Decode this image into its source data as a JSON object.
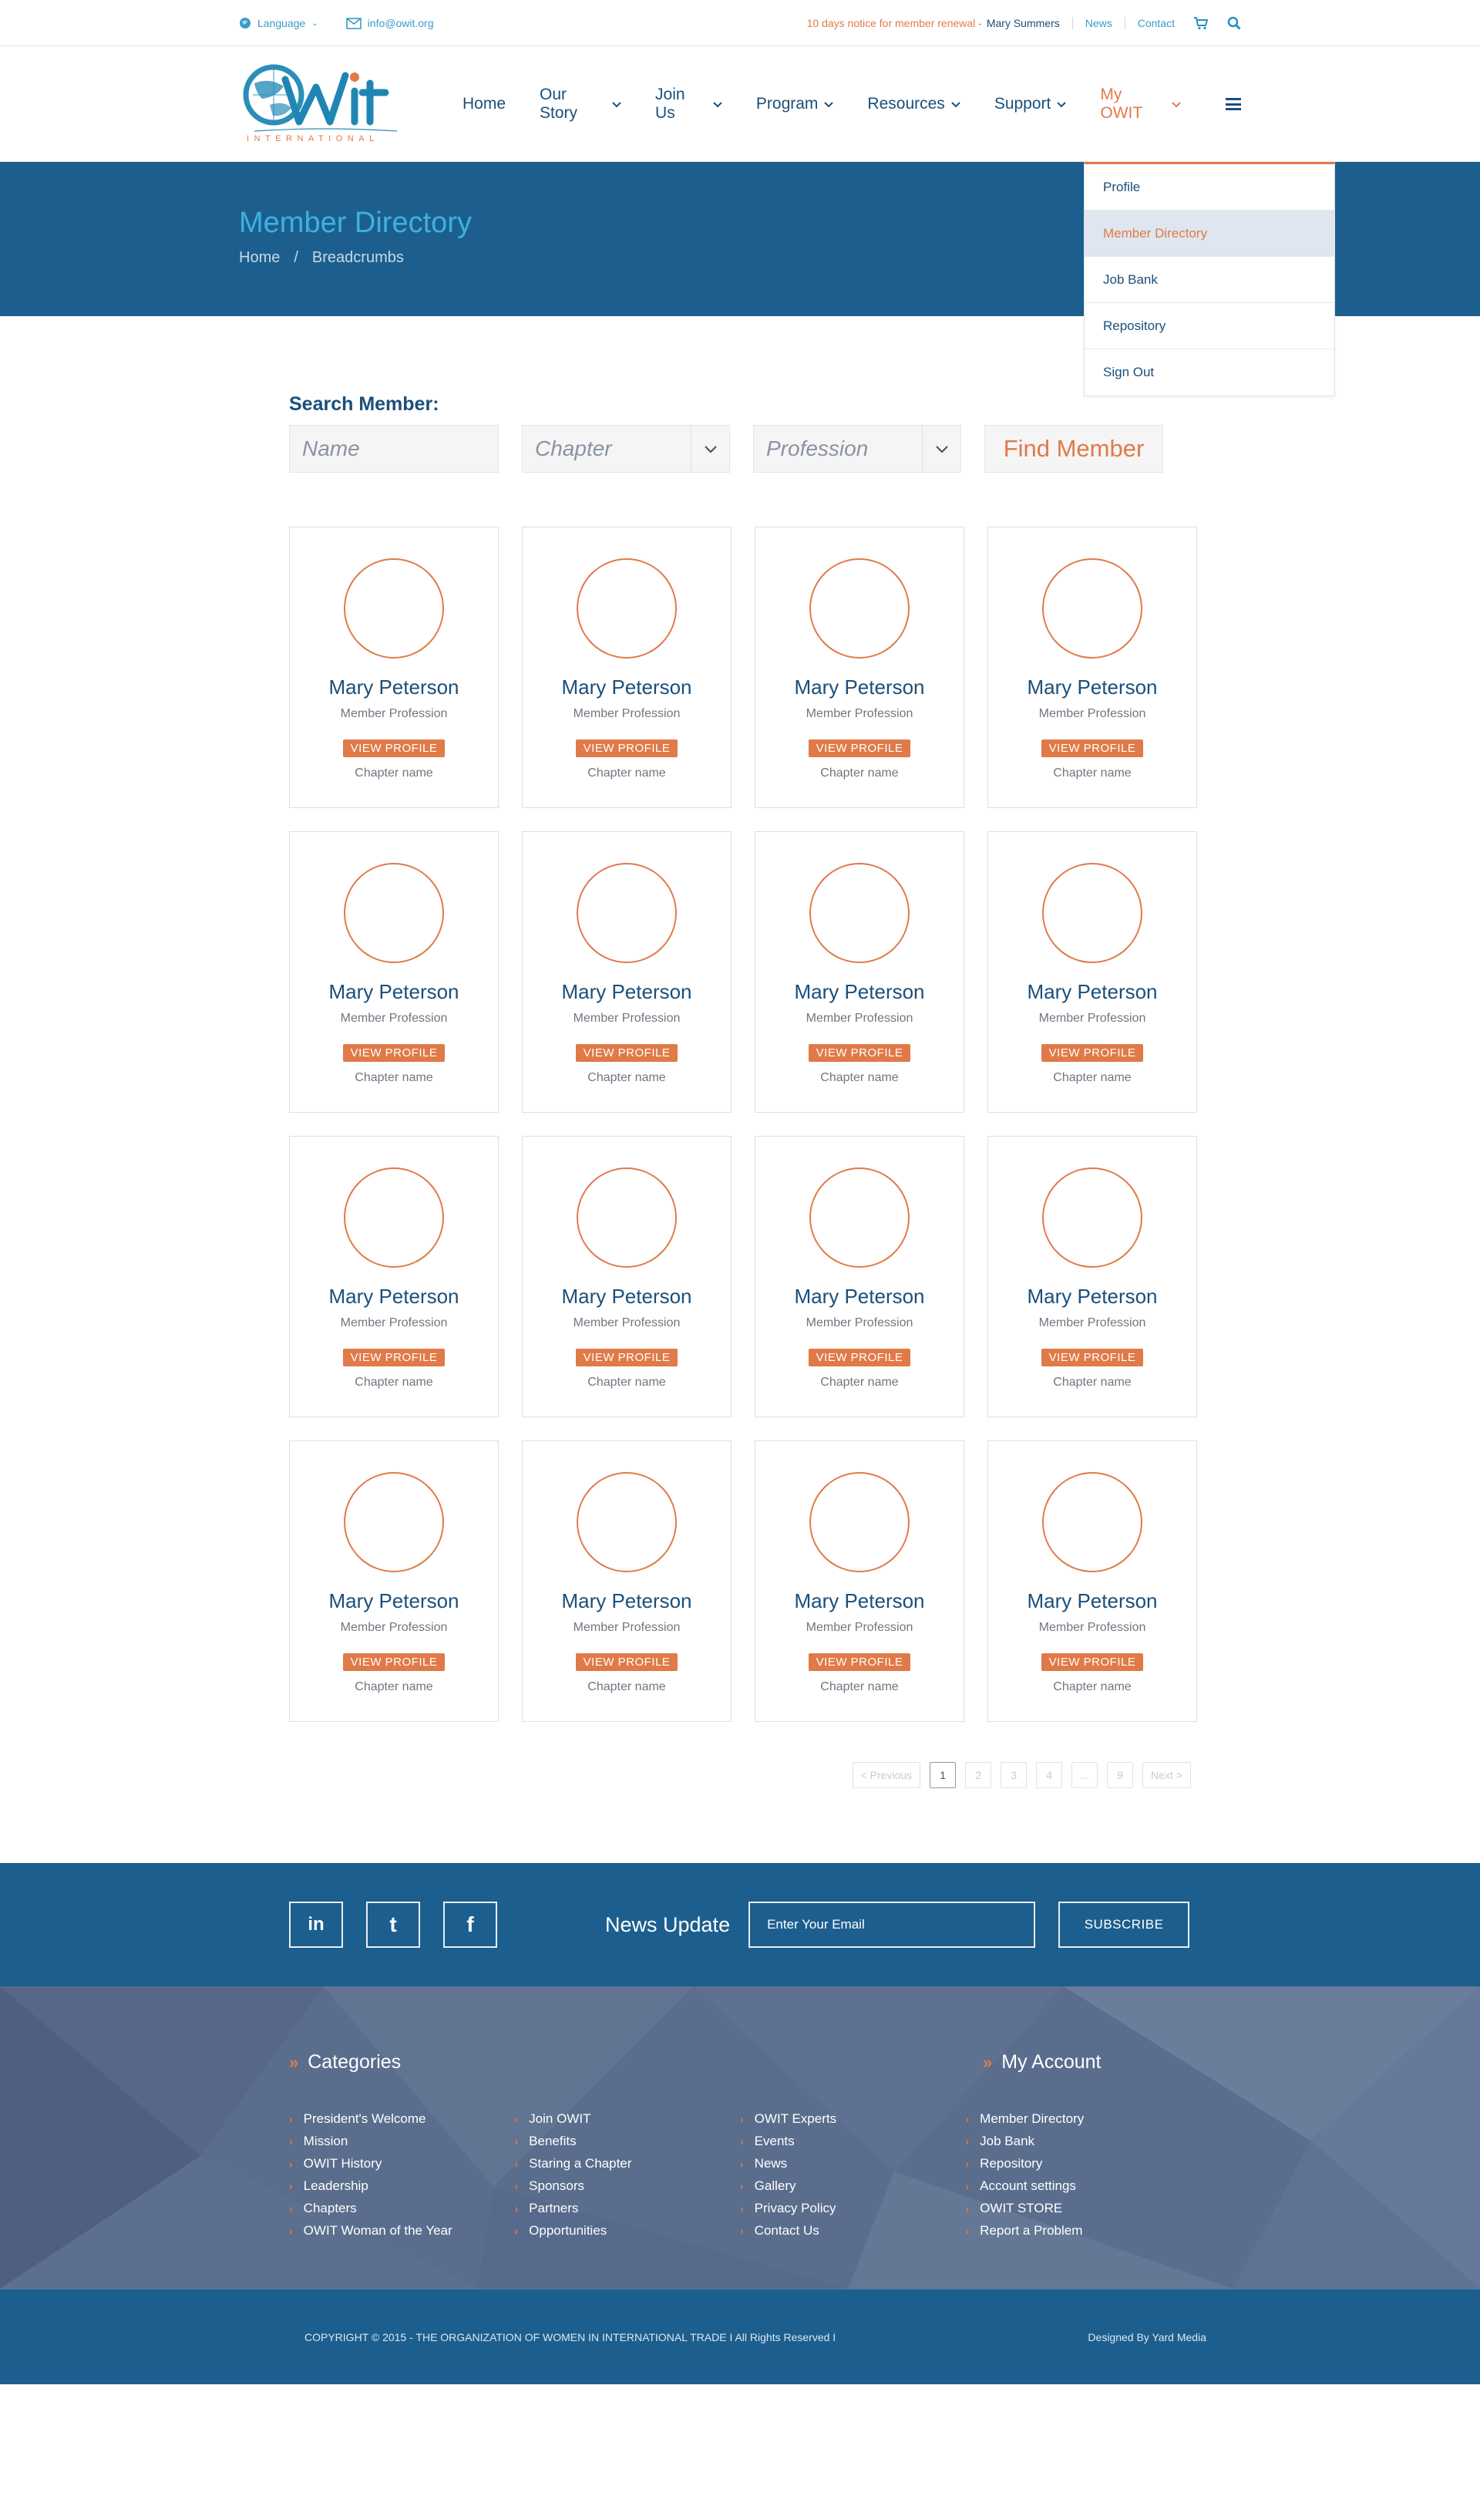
{
  "topbar": {
    "language": "Language",
    "email": "info@owit.org",
    "notice": "10 days notice for member renewal -",
    "user": "Mary Summers",
    "news": "News",
    "contact": "Contact"
  },
  "logo": {
    "word": "Owit",
    "sub": "INTERNATIONAL"
  },
  "nav": [
    {
      "label": "Home"
    },
    {
      "label": "Our Story",
      "chevron": true
    },
    {
      "label": "Join Us",
      "chevron": true
    },
    {
      "label": "Program",
      "chevron": true
    },
    {
      "label": "Resources",
      "chevron": true
    },
    {
      "label": "Support",
      "chevron": true
    },
    {
      "label": "My OWIT",
      "chevron": true,
      "active": true
    }
  ],
  "banner": {
    "title": "Member Directory",
    "crumb_home": "Home",
    "crumb_sep": "/",
    "crumb_current": "Breadcrumbs"
  },
  "dropdown": [
    {
      "label": "Profile"
    },
    {
      "label": "Member Directory",
      "active": true
    },
    {
      "label": "Job Bank"
    },
    {
      "label": "Repository"
    },
    {
      "label": "Sign Out"
    }
  ],
  "search": {
    "label": "Search Member:",
    "name_placeholder": "Name",
    "chapter_placeholder": "Chapter",
    "profession_placeholder": "Profession",
    "button": "Find Member"
  },
  "members": [
    {
      "name": "Mary Peterson",
      "profession": "Member Profession",
      "action": "VIEW PROFILE",
      "chapter": "Chapter name"
    },
    {
      "name": "Mary Peterson",
      "profession": "Member Profession",
      "action": "VIEW PROFILE",
      "chapter": "Chapter name"
    },
    {
      "name": "Mary Peterson",
      "profession": "Member Profession",
      "action": "VIEW PROFILE",
      "chapter": "Chapter name"
    },
    {
      "name": "Mary Peterson",
      "profession": "Member Profession",
      "action": "VIEW PROFILE",
      "chapter": "Chapter name"
    },
    {
      "name": "Mary Peterson",
      "profession": "Member Profession",
      "action": "VIEW PROFILE",
      "chapter": "Chapter name"
    },
    {
      "name": "Mary Peterson",
      "profession": "Member Profession",
      "action": "VIEW PROFILE",
      "chapter": "Chapter name"
    },
    {
      "name": "Mary Peterson",
      "profession": "Member Profession",
      "action": "VIEW PROFILE",
      "chapter": "Chapter name"
    },
    {
      "name": "Mary Peterson",
      "profession": "Member Profession",
      "action": "VIEW PROFILE",
      "chapter": "Chapter name"
    },
    {
      "name": "Mary Peterson",
      "profession": "Member Profession",
      "action": "VIEW PROFILE",
      "chapter": "Chapter name"
    },
    {
      "name": "Mary Peterson",
      "profession": "Member Profession",
      "action": "VIEW PROFILE",
      "chapter": "Chapter name"
    },
    {
      "name": "Mary Peterson",
      "profession": "Member Profession",
      "action": "VIEW PROFILE",
      "chapter": "Chapter name"
    },
    {
      "name": "Mary Peterson",
      "profession": "Member Profession",
      "action": "VIEW PROFILE",
      "chapter": "Chapter name"
    },
    {
      "name": "Mary Peterson",
      "profession": "Member Profession",
      "action": "VIEW PROFILE",
      "chapter": "Chapter name"
    },
    {
      "name": "Mary Peterson",
      "profession": "Member Profession",
      "action": "VIEW PROFILE",
      "chapter": "Chapter name"
    },
    {
      "name": "Mary Peterson",
      "profession": "Member Profession",
      "action": "VIEW PROFILE",
      "chapter": "Chapter name"
    },
    {
      "name": "Mary Peterson",
      "profession": "Member Profession",
      "action": "VIEW PROFILE",
      "chapter": "Chapter name"
    }
  ],
  "pagination": [
    "< Previous",
    "1",
    "2",
    "3",
    "4",
    "...",
    "9",
    "Next >"
  ],
  "pagination_current": "1",
  "newsletter": {
    "social": [
      "in",
      "t",
      "f"
    ],
    "title": "News Update",
    "email_placeholder": "Enter Your Email",
    "subscribe": "SUBSCRIBE"
  },
  "footer": {
    "categories_title": "Categories",
    "account_title": "My Account",
    "columns": [
      [
        "President's Welcome",
        "Mission",
        "OWIT History",
        "Leadership",
        "Chapters",
        "OWIT Woman of the Year"
      ],
      [
        "Join OWIT",
        "Benefits",
        "Staring a Chapter",
        "Sponsors",
        "Partners",
        "Opportunities"
      ],
      [
        "OWIT Experts",
        "Events",
        "News",
        "Gallery",
        "Privacy Policy",
        "Contact Us"
      ],
      [
        "Member Directory",
        "Job Bank",
        "Repository",
        "Account settings",
        "OWIT STORE",
        "Report a Problem"
      ]
    ],
    "copyright": "COPYRIGHT © 2015 - THE ORGANIZATION OF WOMEN IN INTERNATIONAL TRADE  I  All Rights Reserved  I",
    "designed_by": "Designed By Yard Media"
  },
  "colors": {
    "primary": "#1c5f8e",
    "accent": "#e07a48",
    "light_blue": "#3fb0e0"
  }
}
